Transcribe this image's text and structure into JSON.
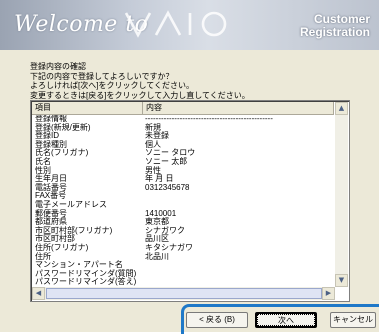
{
  "banner": {
    "welcome": "Welcome to",
    "logo": "VAIO",
    "title_line1": "Customer",
    "title_line2": "Registration"
  },
  "intro": [
    "登録内容の確認",
    "下記の内容で登録してよろしいですか？",
    "よろしければ[次へ]をクリックしてください。",
    "変更するときは[戻る]をクリックして入力し直してください。"
  ],
  "table": {
    "columns": [
      "項目",
      "内容"
    ],
    "rows": [
      [
        "登録情報",
        "------------------------------------------------"
      ],
      [
        "登録(新規/更新)",
        "新規"
      ],
      [
        "登録ID",
        "未登録"
      ],
      [
        "登録種別",
        "個人"
      ],
      [
        "氏名(フリガナ)",
        "ソニー タロウ"
      ],
      [
        "氏名",
        "ソニー 太郎"
      ],
      [
        "性別",
        "男性"
      ],
      [
        "生年月日",
        "年 月 日"
      ],
      [
        "電話番号",
        "0312345678"
      ],
      [
        "FAX番号",
        ""
      ],
      [
        "電子メールアドレス",
        ""
      ],
      [
        "郵便番号",
        "1410001"
      ],
      [
        "都道府県",
        "東京都"
      ],
      [
        "市区町村部(フリガナ)",
        "シナガワク"
      ],
      [
        "市区町村部",
        "品川区"
      ],
      [
        "住所(フリガナ)",
        "キタシナガワ"
      ],
      [
        "住所",
        "北品川"
      ],
      [
        "マンション・アパート名",
        ""
      ],
      [
        "パスワードリマインダ(質問)",
        ""
      ],
      [
        "パスワードリマインダ(答え)",
        ""
      ]
    ]
  },
  "buttons": {
    "back": "< 戻る (B)",
    "next": "次へ",
    "cancel": "キャンセル"
  },
  "colors": {
    "focus_highlight": "#1e78c8"
  }
}
